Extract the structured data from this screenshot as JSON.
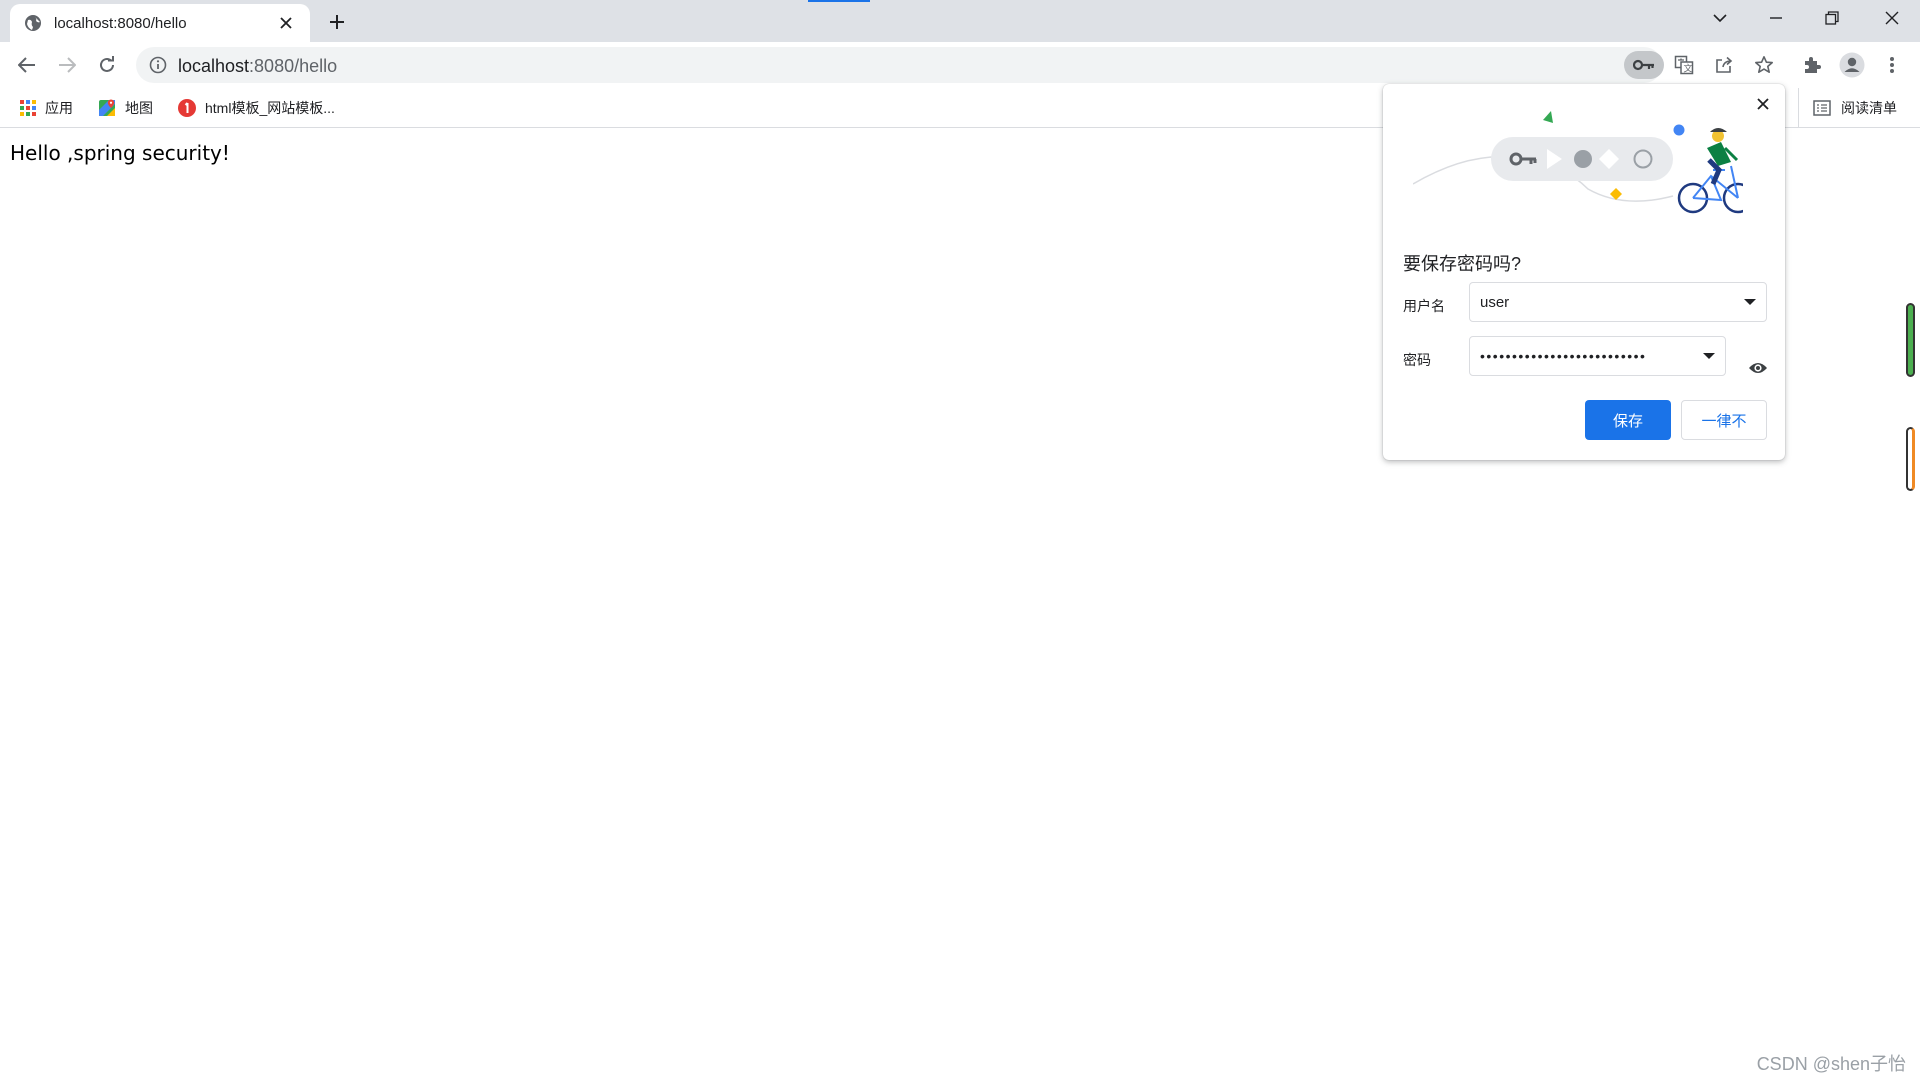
{
  "tab": {
    "title": "localhost:8080/hello",
    "favicon": "globe-icon"
  },
  "omnibox": {
    "host": "localhost",
    "path": ":8080/hello",
    "icons": [
      "key-icon",
      "translate-icon",
      "share-icon",
      "star-icon"
    ]
  },
  "toolbar_icons": [
    "extensions-icon",
    "profile-icon",
    "menu-icon"
  ],
  "bookmarks": {
    "items": [
      {
        "label": "应用",
        "icon": "apps-grid-icon"
      },
      {
        "label": "地图",
        "icon": "maps-icon"
      },
      {
        "label": "html模板_网站模板...",
        "icon": "bookmark-site-icon"
      }
    ],
    "reading_list": "阅读清单"
  },
  "page": {
    "text": "Hello ,spring security!"
  },
  "password_bubble": {
    "title": "要保存密码吗?",
    "username_label": "用户名",
    "username_value": "user",
    "password_label": "密码",
    "password_value": "••••••••••••••••••••••••••",
    "save_label": "保存",
    "never_label": "一律不"
  },
  "watermark": "CSDN @shen子怡",
  "colors": {
    "accent": "#1a73e8",
    "tabstrip": "#dee1e6",
    "omnibox": "#f1f3f4"
  }
}
